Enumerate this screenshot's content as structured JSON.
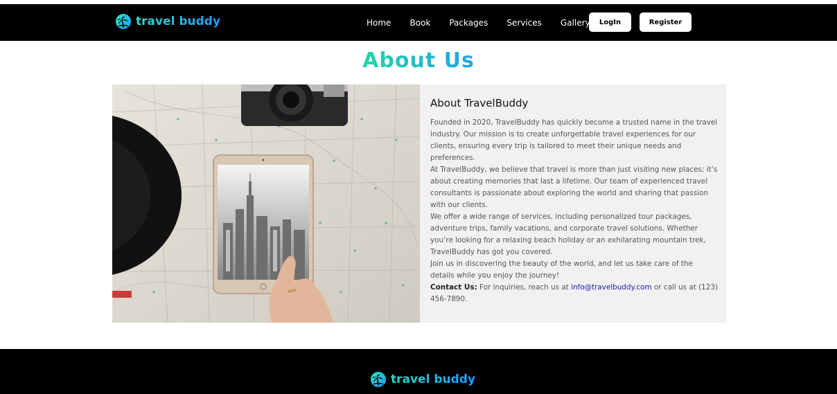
{
  "header": {
    "logo_text": "travel buddy",
    "nav": [
      "Home",
      "Book",
      "Packages",
      "Services",
      "Gallery"
    ],
    "login_label": "LogIn",
    "register_label": "Register"
  },
  "page_title": "About Us",
  "about": {
    "heading": "About TravelBuddy",
    "paragraphs": [
      "Founded in 2020, TravelBuddy has quickly become a trusted name in the travel industry. Our mission is to create unforgettable travel experiences for our clients, ensuring every trip is tailored to meet their unique needs and preferences.",
      "At TravelBuddy, we believe that travel is more than just visiting new places; it’s about creating memories that last a lifetime. Our team of experienced travel consultants is passionate about exploring the world and sharing that passion with our clients.",
      "We offer a wide range of services, including personalized tour packages, adventure trips, family vacations, and corporate travel solutions. Whether you’re looking for a relaxing beach holiday or an exhilarating mountain trek, TravelBuddy has got you covered.",
      "Join us in discovering the beauty of the world, and let us take care of the details while you enjoy the journey!"
    ],
    "contact": {
      "label": "Contact Us:",
      "before_email": " For inquiries, reach us at ",
      "email": "info@travelbuddy.com",
      "after_email": " or call us at (123) 456-7890."
    }
  },
  "footer": {
    "logo_text": "travel buddy"
  },
  "colors": {
    "brand_gradient_start": "#2ee6b8",
    "brand_gradient_end": "#1e9bff",
    "header_bg": "#000000",
    "section_bg": "#f1f1f1",
    "link": "#1a1aa6"
  },
  "icons": {
    "logo": "palm-globe-icon"
  }
}
